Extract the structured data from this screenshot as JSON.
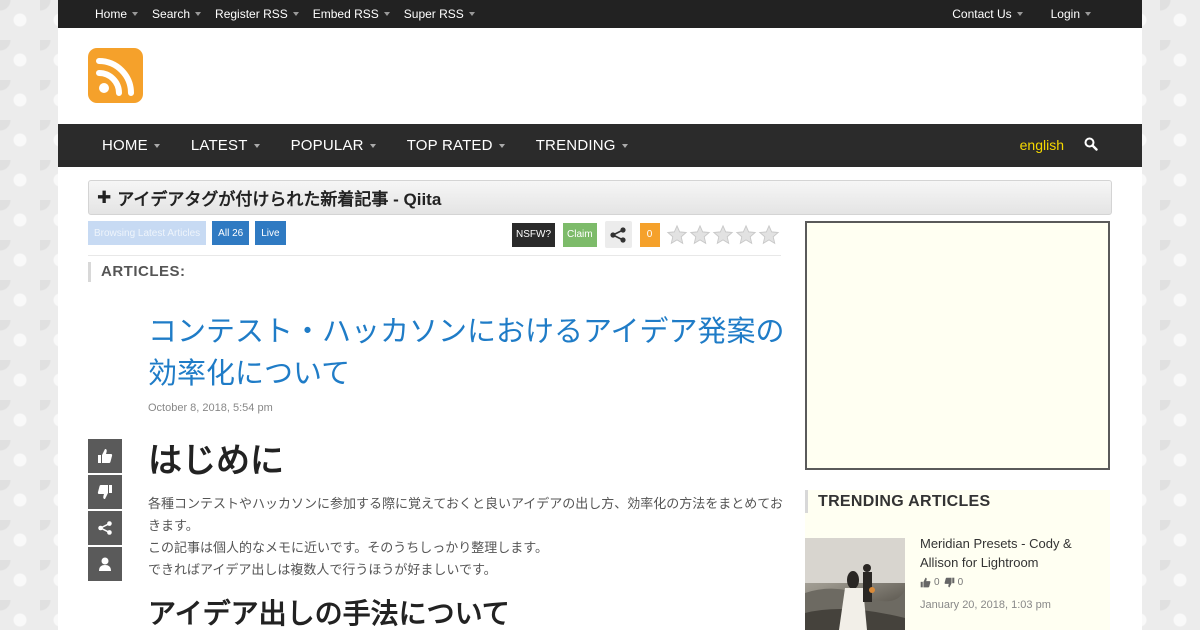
{
  "topbar": {
    "left": [
      "Home",
      "Search",
      "Register RSS",
      "Embed RSS",
      "Super RSS"
    ],
    "contact": "Contact Us",
    "login": "Login"
  },
  "mainnav": {
    "items": [
      "HOME",
      "LATEST",
      "POPULAR",
      "TOP RATED",
      "TRENDING"
    ],
    "language": "english"
  },
  "feed": {
    "title": "アイデアタグが付けられた新着記事 - Qiita"
  },
  "toolbar": {
    "browsing": "Browsing Latest Articles",
    "all": "All 26",
    "live": "Live",
    "nsfw": "NSFW?",
    "claim": "Claim",
    "count": "0",
    "rating": 0
  },
  "articles_heading": "ARTICLES:",
  "post": {
    "title": "コンテスト・ハッカソンにおけるアイデア発案の効率化について",
    "date": "October 8, 2018, 5:54 pm",
    "heading1": "はじめに",
    "paragraphs": [
      "各種コンテストやハッカソンに参加する際に覚えておくと良いアイデアの出し方、効率化の方法をまとめておきます。",
      "この記事は個人的なメモに近いです。そのうちしっかり整理します。",
      "できればアイデア出しは複数人で行うほうが好ましいです。"
    ],
    "heading2": "アイデア出しの手法について"
  },
  "trending": {
    "heading": "TRENDING ARTICLES",
    "item": {
      "title": "Meridian Presets - Cody & Allison for Lightroom",
      "likes": "0",
      "dislikes": "0",
      "date": "January 20, 2018, 1:03 pm"
    }
  },
  "colors": {
    "accent": "#f5a12b",
    "link": "#1f7cc7",
    "nav_bg": "#2b2b2b",
    "topbar_bg": "#222222",
    "language": "#f5d800"
  }
}
